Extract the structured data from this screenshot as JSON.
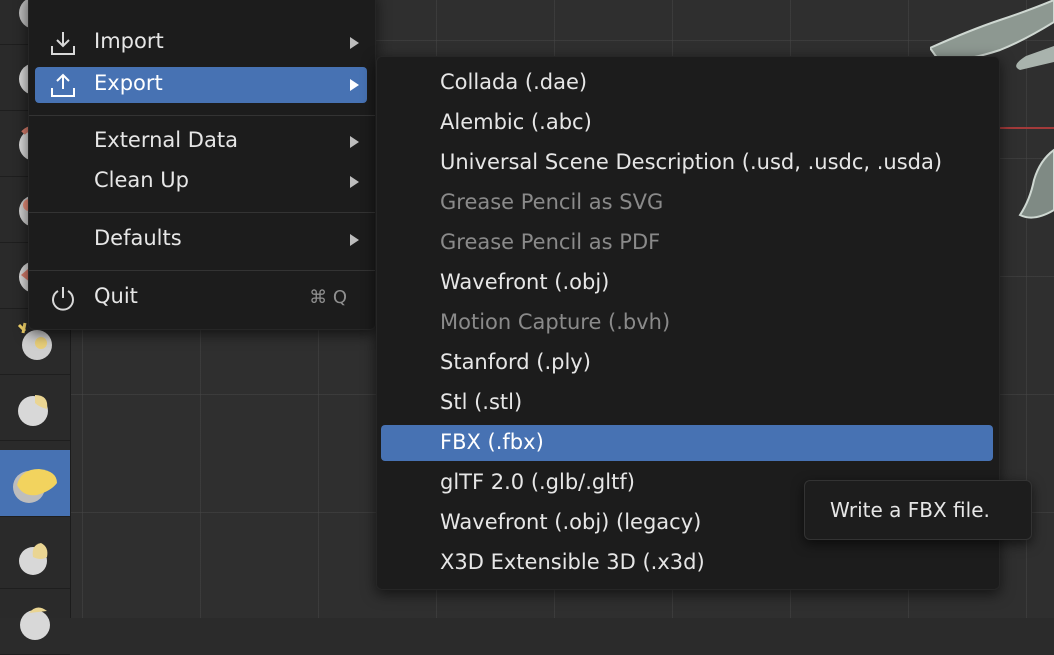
{
  "file_menu": {
    "items": [
      {
        "label": "Import",
        "icon": "import-icon",
        "has_submenu": true
      },
      {
        "label": "Export",
        "icon": "export-icon",
        "has_submenu": true,
        "selected": true
      },
      {
        "label": "External Data",
        "has_submenu": true
      },
      {
        "label": "Clean Up",
        "has_submenu": true
      },
      {
        "label": "Defaults",
        "has_submenu": true
      },
      {
        "label": "Quit",
        "icon": "power-icon",
        "shortcut": "⌘ Q"
      }
    ]
  },
  "export_menu": {
    "items": [
      {
        "label": "Collada (.dae)",
        "enabled": true
      },
      {
        "label": "Alembic (.abc)",
        "enabled": true
      },
      {
        "label": "Universal Scene Description (.usd, .usdc, .usda)",
        "enabled": true
      },
      {
        "label": "Grease Pencil as SVG",
        "enabled": false
      },
      {
        "label": "Grease Pencil as PDF",
        "enabled": false
      },
      {
        "label": "Wavefront (.obj)",
        "enabled": true
      },
      {
        "label": "Motion Capture (.bvh)",
        "enabled": false
      },
      {
        "label": "Stanford (.ply)",
        "enabled": true
      },
      {
        "label": "Stl (.stl)",
        "enabled": true
      },
      {
        "label": "FBX (.fbx)",
        "enabled": true,
        "selected": true
      },
      {
        "label": "glTF 2.0 (.glb/.gltf)",
        "enabled": true
      },
      {
        "label": "Wavefront (.obj) (legacy)",
        "enabled": true
      },
      {
        "label": "X3D Extensible 3D (.x3d)",
        "enabled": true
      }
    ]
  },
  "tooltip": {
    "text": "Write a FBX file."
  },
  "colors": {
    "accent": "#4772b3",
    "menu_bg": "#1c1c1c",
    "disabled_text": "#8a8a8a"
  }
}
